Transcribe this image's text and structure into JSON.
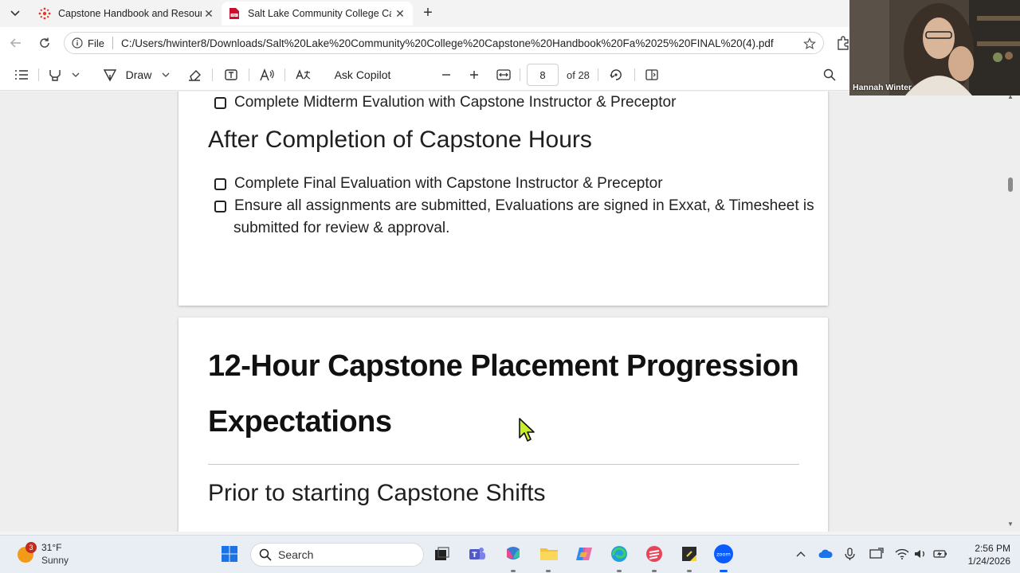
{
  "browser": {
    "tabs": [
      {
        "label": "Capstone Handbook and Resources",
        "active": false
      },
      {
        "label": "Salt Lake Community College Capstone Handbook",
        "active": true
      }
    ],
    "address": {
      "scheme_label": "File",
      "url": "C:/Users/hwinter8/Downloads/Salt%20Lake%20Community%20College%20Capstone%20Handbook%20Fa%2025%20FINAL%20(4).pdf"
    }
  },
  "pdf_toolbar": {
    "draw_label": "Draw",
    "ask_copilot_label": "Ask Copilot",
    "current_page": "8",
    "page_count_label": "of 28"
  },
  "document": {
    "page1": {
      "midterm_item": "Complete Midterm Evalution with Capstone Instructor & Preceptor",
      "heading": "After Completion of Capstone Hours",
      "items": [
        "Complete Final Evaluation with Capstone Instructor & Preceptor",
        "Ensure all assignments are submitted, Evaluations are signed in Exxat, & Timesheet is",
        "submitted for review & approval."
      ]
    },
    "page2": {
      "title_line1": "12-Hour Capstone Placement Progression",
      "title_line2": "Expectations",
      "subheading": "Prior to starting Capstone Shifts"
    }
  },
  "video": {
    "participant_name": "Hannah Winter"
  },
  "taskbar": {
    "weather_badge": "3",
    "temperature": "31°F",
    "condition": "Sunny",
    "search_label": "Search",
    "time": "2:56 PM",
    "date": "1/24/2026"
  },
  "colors": {
    "pdf_favicon": "#c8102e",
    "cursor_fill": "#c8f02a",
    "zoom_blue": "#0b5cff",
    "windows_blue": "#1a73e8"
  }
}
